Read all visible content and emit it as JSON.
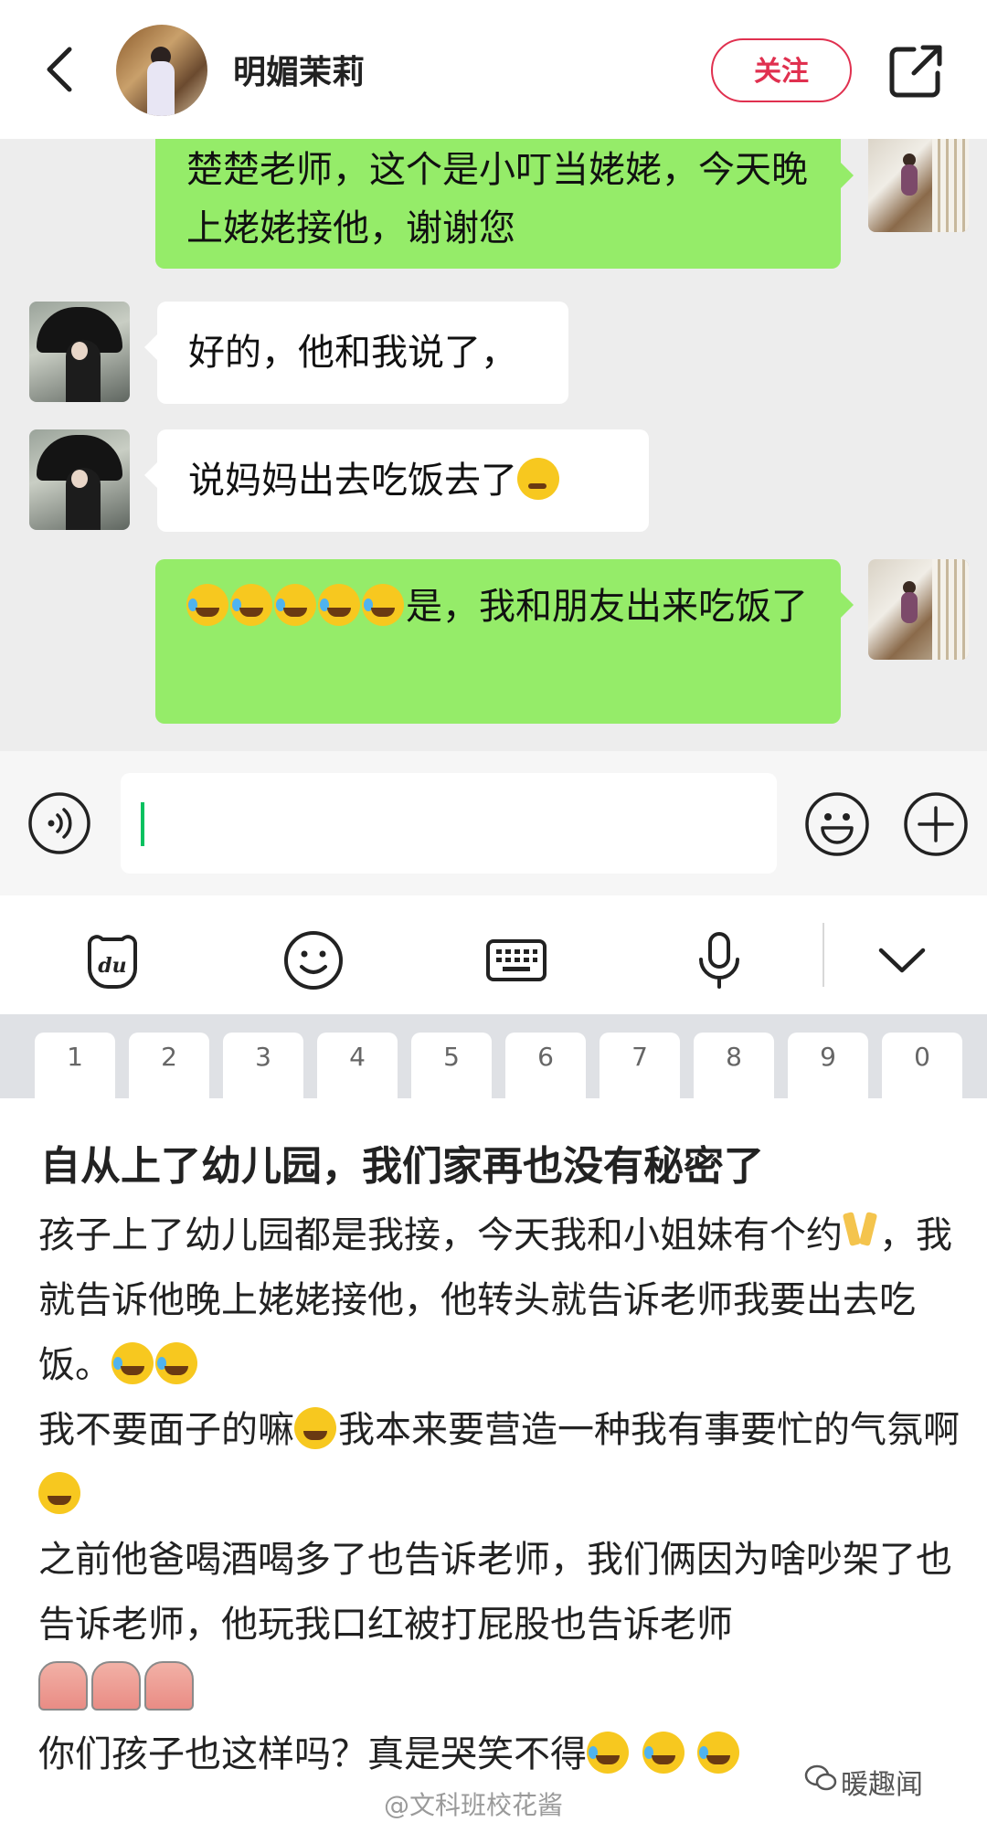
{
  "header": {
    "username": "明媚茉莉",
    "follow_label": "关注",
    "back_icon": "chevron-left-icon",
    "share_icon": "share-icon"
  },
  "chat": {
    "messages": [
      {
        "side": "right",
        "text": "楚楚老师，这个是小叮当姥姥，今天晚上姥姥接他，谢谢您"
      },
      {
        "side": "left",
        "text": "好的，他和我说了，"
      },
      {
        "side": "left",
        "text": "说妈妈出去吃饭去了"
      },
      {
        "side": "right",
        "text": "是，我和朋友出来吃饭了"
      }
    ]
  },
  "input_bar": {
    "voice_icon": "voice-icon",
    "emoji_icon": "smile-icon",
    "more_icon": "plus-icon"
  },
  "keyboard": {
    "toolbar_icons": [
      "du-bear-icon",
      "emoji-icon",
      "keyboard-icon",
      "microphone-icon",
      "collapse-chevron-icon"
    ],
    "number_row": [
      "1",
      "2",
      "3",
      "4",
      "5",
      "6",
      "7",
      "8",
      "9",
      "0"
    ]
  },
  "post": {
    "title": "自从上了幼儿园，我们家再也没有秘密了",
    "para1_a": "孩子上了幼儿园都是我接，今天我和小姐妹有个约",
    "para1_b": "，我就告诉他晚上姥姥接他，他转头就告诉老师我要出去吃饭。",
    "para2_a": "我不要面子的嘛",
    "para2_b": "我本来要营造一种我有事要忙的气氛啊",
    "para3": "之前他爸喝酒喝多了也告诉老师，我们俩因为啥吵架了也告诉老师，他玩我口红被打屁股也告诉老师",
    "para4": "你们孩子也这样吗？真是哭笑不得"
  },
  "watermark": "@文科班校花酱",
  "brand": "暖趣闻",
  "colors": {
    "accent_red": "#e0304f",
    "bubble_green": "#95ec69",
    "chat_bg": "#ededed",
    "caret_green": "#07c160"
  }
}
